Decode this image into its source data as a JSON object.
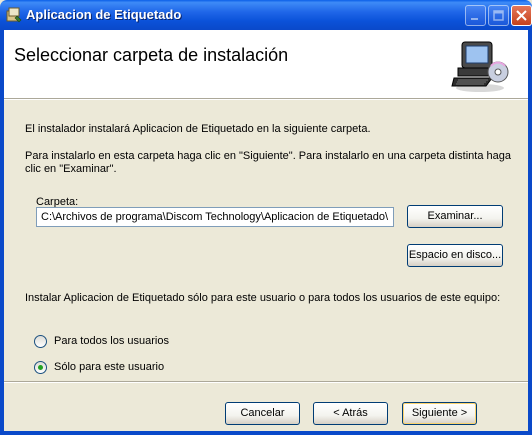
{
  "window": {
    "title": "Aplicacion de Etiquetado",
    "minimize_label": "Minimizar",
    "maximize_label": "Maximizar",
    "close_label": "Cerrar"
  },
  "banner": {
    "title": "Seleccionar carpeta de instalación",
    "image": "computer-with-cd-icon"
  },
  "body": {
    "intro": "El instalador instalará Aplicacion de Etiquetado en la siguiente carpeta.",
    "instructions": "Para instalarlo en esta carpeta haga clic en \"Siguiente\". Para instalarlo en una carpeta distinta haga clic en \"Examinar\".",
    "folder_label": "Carpeta:",
    "folder_value": "C:\\Archivos de programa\\Discom Technology\\Aplicacion de Etiquetado\\",
    "browse_button": "Examinar...",
    "disk_space_button": "Espacio en disco...",
    "scope_question": "Instalar Aplicacion de Etiquetado sólo para este usuario o para todos los usuarios de este equipo:",
    "scope_options": [
      {
        "label": "Para todos los usuarios",
        "selected": false
      },
      {
        "label": "Sólo para este usuario",
        "selected": true
      }
    ]
  },
  "footer": {
    "cancel": "Cancelar",
    "back": "< Atrás",
    "next": "Siguiente >"
  },
  "colors": {
    "titlebar": "#0A5FE8",
    "dialog_bg": "#ECE9D8",
    "radio_dot": "#21A121",
    "button_border": "#003C74"
  }
}
